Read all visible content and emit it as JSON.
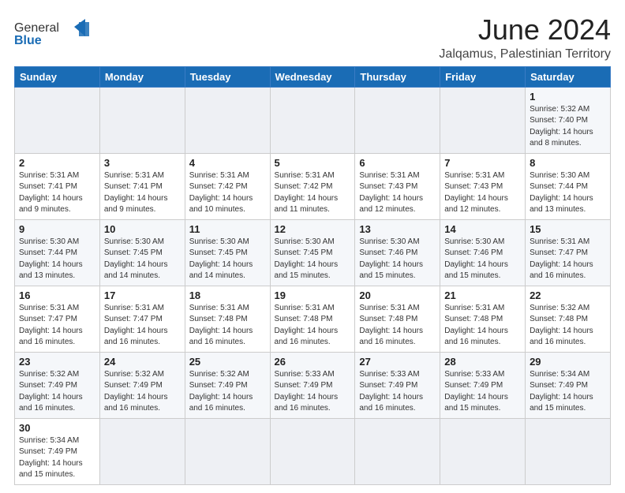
{
  "header": {
    "logo_general": "General",
    "logo_blue": "Blue",
    "month_title": "June 2024",
    "location": "Jalqamus, Palestinian Territory"
  },
  "weekdays": [
    "Sunday",
    "Monday",
    "Tuesday",
    "Wednesday",
    "Thursday",
    "Friday",
    "Saturday"
  ],
  "weeks": [
    [
      {
        "day": "",
        "sunrise": "",
        "sunset": "",
        "daylight": ""
      },
      {
        "day": "",
        "sunrise": "",
        "sunset": "",
        "daylight": ""
      },
      {
        "day": "",
        "sunrise": "",
        "sunset": "",
        "daylight": ""
      },
      {
        "day": "",
        "sunrise": "",
        "sunset": "",
        "daylight": ""
      },
      {
        "day": "",
        "sunrise": "",
        "sunset": "",
        "daylight": ""
      },
      {
        "day": "",
        "sunrise": "",
        "sunset": "",
        "daylight": ""
      },
      {
        "day": "1",
        "sunrise": "Sunrise: 5:32 AM",
        "sunset": "Sunset: 7:40 PM",
        "daylight": "Daylight: 14 hours and 8 minutes."
      }
    ],
    [
      {
        "day": "2",
        "sunrise": "Sunrise: 5:31 AM",
        "sunset": "Sunset: 7:41 PM",
        "daylight": "Daylight: 14 hours and 9 minutes."
      },
      {
        "day": "3",
        "sunrise": "Sunrise: 5:31 AM",
        "sunset": "Sunset: 7:41 PM",
        "daylight": "Daylight: 14 hours and 9 minutes."
      },
      {
        "day": "4",
        "sunrise": "Sunrise: 5:31 AM",
        "sunset": "Sunset: 7:42 PM",
        "daylight": "Daylight: 14 hours and 10 minutes."
      },
      {
        "day": "5",
        "sunrise": "Sunrise: 5:31 AM",
        "sunset": "Sunset: 7:42 PM",
        "daylight": "Daylight: 14 hours and 11 minutes."
      },
      {
        "day": "6",
        "sunrise": "Sunrise: 5:31 AM",
        "sunset": "Sunset: 7:43 PM",
        "daylight": "Daylight: 14 hours and 12 minutes."
      },
      {
        "day": "7",
        "sunrise": "Sunrise: 5:31 AM",
        "sunset": "Sunset: 7:43 PM",
        "daylight": "Daylight: 14 hours and 12 minutes."
      },
      {
        "day": "8",
        "sunrise": "Sunrise: 5:30 AM",
        "sunset": "Sunset: 7:44 PM",
        "daylight": "Daylight: 14 hours and 13 minutes."
      }
    ],
    [
      {
        "day": "9",
        "sunrise": "Sunrise: 5:30 AM",
        "sunset": "Sunset: 7:44 PM",
        "daylight": "Daylight: 14 hours and 13 minutes."
      },
      {
        "day": "10",
        "sunrise": "Sunrise: 5:30 AM",
        "sunset": "Sunset: 7:45 PM",
        "daylight": "Daylight: 14 hours and 14 minutes."
      },
      {
        "day": "11",
        "sunrise": "Sunrise: 5:30 AM",
        "sunset": "Sunset: 7:45 PM",
        "daylight": "Daylight: 14 hours and 14 minutes."
      },
      {
        "day": "12",
        "sunrise": "Sunrise: 5:30 AM",
        "sunset": "Sunset: 7:45 PM",
        "daylight": "Daylight: 14 hours and 15 minutes."
      },
      {
        "day": "13",
        "sunrise": "Sunrise: 5:30 AM",
        "sunset": "Sunset: 7:46 PM",
        "daylight": "Daylight: 14 hours and 15 minutes."
      },
      {
        "day": "14",
        "sunrise": "Sunrise: 5:30 AM",
        "sunset": "Sunset: 7:46 PM",
        "daylight": "Daylight: 14 hours and 15 minutes."
      },
      {
        "day": "15",
        "sunrise": "Sunrise: 5:31 AM",
        "sunset": "Sunset: 7:47 PM",
        "daylight": "Daylight: 14 hours and 16 minutes."
      }
    ],
    [
      {
        "day": "16",
        "sunrise": "Sunrise: 5:31 AM",
        "sunset": "Sunset: 7:47 PM",
        "daylight": "Daylight: 14 hours and 16 minutes."
      },
      {
        "day": "17",
        "sunrise": "Sunrise: 5:31 AM",
        "sunset": "Sunset: 7:47 PM",
        "daylight": "Daylight: 14 hours and 16 minutes."
      },
      {
        "day": "18",
        "sunrise": "Sunrise: 5:31 AM",
        "sunset": "Sunset: 7:48 PM",
        "daylight": "Daylight: 14 hours and 16 minutes."
      },
      {
        "day": "19",
        "sunrise": "Sunrise: 5:31 AM",
        "sunset": "Sunset: 7:48 PM",
        "daylight": "Daylight: 14 hours and 16 minutes."
      },
      {
        "day": "20",
        "sunrise": "Sunrise: 5:31 AM",
        "sunset": "Sunset: 7:48 PM",
        "daylight": "Daylight: 14 hours and 16 minutes."
      },
      {
        "day": "21",
        "sunrise": "Sunrise: 5:31 AM",
        "sunset": "Sunset: 7:48 PM",
        "daylight": "Daylight: 14 hours and 16 minutes."
      },
      {
        "day": "22",
        "sunrise": "Sunrise: 5:32 AM",
        "sunset": "Sunset: 7:48 PM",
        "daylight": "Daylight: 14 hours and 16 minutes."
      }
    ],
    [
      {
        "day": "23",
        "sunrise": "Sunrise: 5:32 AM",
        "sunset": "Sunset: 7:49 PM",
        "daylight": "Daylight: 14 hours and 16 minutes."
      },
      {
        "day": "24",
        "sunrise": "Sunrise: 5:32 AM",
        "sunset": "Sunset: 7:49 PM",
        "daylight": "Daylight: 14 hours and 16 minutes."
      },
      {
        "day": "25",
        "sunrise": "Sunrise: 5:32 AM",
        "sunset": "Sunset: 7:49 PM",
        "daylight": "Daylight: 14 hours and 16 minutes."
      },
      {
        "day": "26",
        "sunrise": "Sunrise: 5:33 AM",
        "sunset": "Sunset: 7:49 PM",
        "daylight": "Daylight: 14 hours and 16 minutes."
      },
      {
        "day": "27",
        "sunrise": "Sunrise: 5:33 AM",
        "sunset": "Sunset: 7:49 PM",
        "daylight": "Daylight: 14 hours and 16 minutes."
      },
      {
        "day": "28",
        "sunrise": "Sunrise: 5:33 AM",
        "sunset": "Sunset: 7:49 PM",
        "daylight": "Daylight: 14 hours and 15 minutes."
      },
      {
        "day": "29",
        "sunrise": "Sunrise: 5:34 AM",
        "sunset": "Sunset: 7:49 PM",
        "daylight": "Daylight: 14 hours and 15 minutes."
      }
    ],
    [
      {
        "day": "30",
        "sunrise": "Sunrise: 5:34 AM",
        "sunset": "Sunset: 7:49 PM",
        "daylight": "Daylight: 14 hours and 15 minutes."
      },
      {
        "day": "",
        "sunrise": "",
        "sunset": "",
        "daylight": ""
      },
      {
        "day": "",
        "sunrise": "",
        "sunset": "",
        "daylight": ""
      },
      {
        "day": "",
        "sunrise": "",
        "sunset": "",
        "daylight": ""
      },
      {
        "day": "",
        "sunrise": "",
        "sunset": "",
        "daylight": ""
      },
      {
        "day": "",
        "sunrise": "",
        "sunset": "",
        "daylight": ""
      },
      {
        "day": "",
        "sunrise": "",
        "sunset": "",
        "daylight": ""
      }
    ]
  ]
}
